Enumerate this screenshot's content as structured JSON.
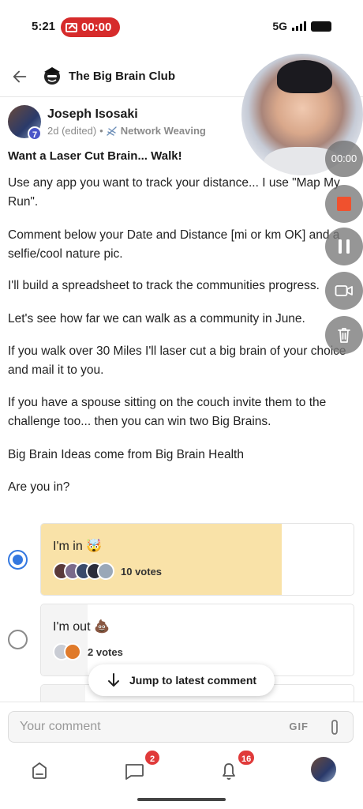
{
  "status_bar": {
    "time": "5:21",
    "recording_timer": "00:00",
    "network": "5G"
  },
  "header": {
    "club_name": "The Big Brain Club"
  },
  "post": {
    "author": "Joseph Isosaki",
    "author_level": "7",
    "age": "2d (edited)",
    "separator": "•",
    "category": "Network Weaving",
    "title": "Want a Laser Cut Brain... Walk!",
    "paragraphs": [
      "Use any app you want to track your distance... I use \"Map My Run\".",
      "Comment below your Date and Distance [mi or km OK] and a selfie/cool nature pic.",
      "I'll build a spreadsheet to track the communities progress.",
      "Let's see how far we can walk as a community in June.",
      "If you walk over 30 Miles I'll laser cut a big brain of your choice and mail it to you.",
      "If you have a spouse sitting on the couch invite them to the challenge too... then you can win two Big Brains.",
      "Big Brain Ideas come from Big Brain Health",
      "Are you in?"
    ]
  },
  "poll": {
    "options": [
      {
        "label": "I'm in 🤯",
        "votes": "10 votes",
        "selected": true,
        "share": 0.77,
        "fill_color": "#f9e2a8"
      },
      {
        "label": "I'm out 💩",
        "votes": "2 votes",
        "selected": false,
        "share": 0.15,
        "fill_color": "#f4f4f4"
      }
    ]
  },
  "jump_button": {
    "label": "Jump to latest comment"
  },
  "comment_bar": {
    "placeholder": "Your comment",
    "gif_label": "GIF"
  },
  "bottom_nav": {
    "chat_badge": "2",
    "notifications_badge": "16"
  },
  "recording_overlay": {
    "timer": "00:00",
    "record_color": "#f0512e"
  }
}
